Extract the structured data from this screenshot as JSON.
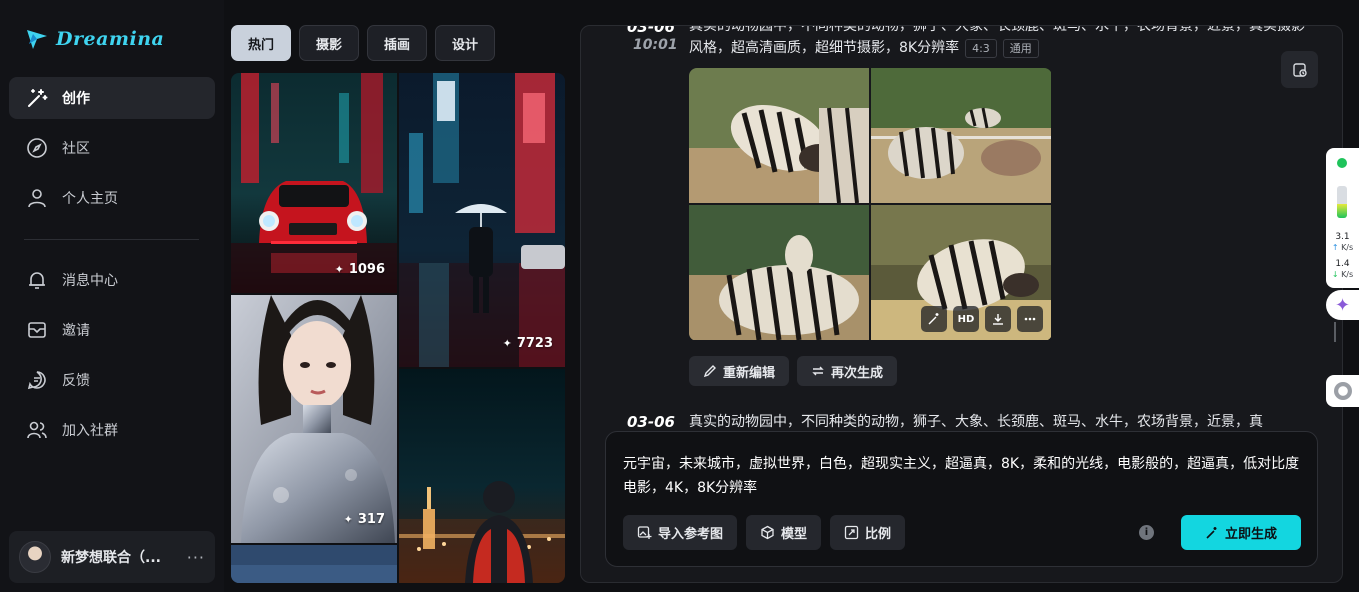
{
  "brand": {
    "name": "Dreamina"
  },
  "sidebar": {
    "items": [
      {
        "label": "创作",
        "icon": "magic-wand-icon",
        "active": true
      },
      {
        "label": "社区",
        "icon": "compass-icon",
        "active": false
      },
      {
        "label": "个人主页",
        "icon": "user-icon",
        "active": false
      }
    ],
    "items2": [
      {
        "label": "消息中心",
        "icon": "bell-icon"
      },
      {
        "label": "邀请",
        "icon": "mail-icon"
      },
      {
        "label": "反馈",
        "icon": "feedback-icon"
      },
      {
        "label": "加入社群",
        "icon": "group-icon"
      }
    ],
    "user": {
      "name": "新梦想联合（...",
      "more": "···"
    }
  },
  "gallery": {
    "tabs": [
      {
        "label": "热门",
        "active": true
      },
      {
        "label": "摄影",
        "active": false
      },
      {
        "label": "插画",
        "active": false
      },
      {
        "label": "设计",
        "active": false
      }
    ],
    "tiles": [
      {
        "subject": "red-car-neon-street",
        "count": "1096"
      },
      {
        "subject": "umbrella-rainy-neon-street",
        "count": "7723"
      },
      {
        "subject": "silver-suit-girl-portrait",
        "count": "317"
      },
      {
        "subject": "city-skyline-night-viewer",
        "count": ""
      },
      {
        "subject": "blue-sky-partial",
        "count": ""
      }
    ]
  },
  "main": {
    "entry1": {
      "date": "03-06",
      "time": "10:01",
      "prompt": "真实的动物园中，不同种类的动物，狮子、大象、长颈鹿、斑马、水牛，农场背景，近景，真实摄影风格，超高清画质，超细节摄影，8K分辨率",
      "ratio": "4:3",
      "model": "通用",
      "image_overlay": {
        "hd_label": "HD"
      },
      "actions": {
        "reedit": "重新编辑",
        "regenerate": "再次生成"
      }
    },
    "entry2": {
      "date": "03-06",
      "prompt": "真实的动物园中，不同种类的动物，狮子、大象、长颈鹿、斑马、水牛，农场背景，近景，真"
    },
    "composer": {
      "text": "元宇宙，未来城市，虚拟世界，白色，超现实主义，超逼真，8K，柔和的光线，电影般的，超逼真，低对比度电影，4K，8K分辨率",
      "import_ref": "导入参考图",
      "model": "模型",
      "ratio": "比例",
      "info": "i",
      "generate": "立即生成"
    }
  },
  "widgets": {
    "net_level": 0.45,
    "upload": {
      "value": "3.1",
      "unit": "K/s"
    },
    "download": {
      "value": "1.4",
      "unit": "K/s"
    }
  },
  "colors": {
    "accent": "#13d6e0",
    "brand": "#3fd4f0",
    "active_tab": "#c9d1dc"
  }
}
